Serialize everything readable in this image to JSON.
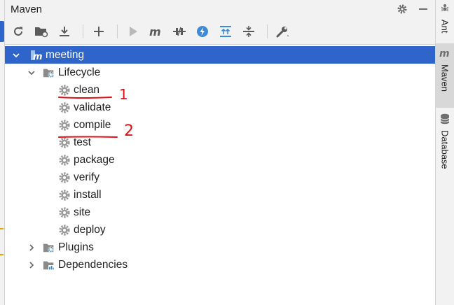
{
  "panel": {
    "title": "Maven"
  },
  "toolbar": {
    "buttons": [
      "reload-icon",
      "add-maven-projects-icon",
      "download-sources-icon",
      "add-icon",
      "run-icon",
      "execute-goal-icon",
      "toggle-offline-icon",
      "skip-tests-icon",
      "show-dependencies-icon",
      "collapse-all-icon",
      "settings-wrench-icon"
    ]
  },
  "tree": {
    "project": "meeting",
    "lifecycle": {
      "label": "Lifecycle",
      "goals": [
        "clean",
        "validate",
        "compile",
        "test",
        "package",
        "verify",
        "install",
        "site",
        "deploy"
      ]
    },
    "plugins": "Plugins",
    "dependencies": "Dependencies"
  },
  "sidebar": {
    "tabs": [
      "Ant",
      "Maven",
      "Database"
    ]
  },
  "annotations": {
    "mark1": "1",
    "mark2": "2"
  },
  "colors": {
    "selection": "#2f65ca",
    "annotation": "#e0101a",
    "accent_gear": "#3d8ad8"
  }
}
